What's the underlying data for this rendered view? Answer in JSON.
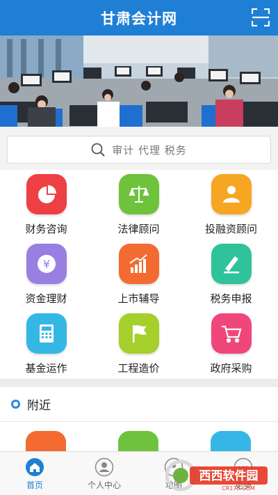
{
  "header": {
    "title": "甘肃会计网"
  },
  "search": {
    "placeholder": "审计 代理 税务"
  },
  "grid": [
    {
      "label": "财务咨询",
      "color": "#ee3f45"
    },
    {
      "label": "法律顾问",
      "color": "#6fc23c"
    },
    {
      "label": "投融资顾问",
      "color": "#f6a623"
    },
    {
      "label": "资金理财",
      "color": "#9a7fe3"
    },
    {
      "label": "上市辅导",
      "color": "#f36b31"
    },
    {
      "label": "税务申报",
      "color": "#2fc39b"
    },
    {
      "label": "基金运作",
      "color": "#35b7e6"
    },
    {
      "label": "工程造价",
      "color": "#a6cf2c"
    },
    {
      "label": "政府采购",
      "color": "#f0477a"
    }
  ],
  "nearby": {
    "label": "附近"
  },
  "bottom_nav": [
    {
      "label": "首页",
      "active": true
    },
    {
      "label": "个人中心",
      "active": false
    },
    {
      "label": "地图",
      "active": false
    },
    {
      "label": "更多",
      "active": false
    }
  ],
  "watermark": {
    "text": "西西软件园",
    "url": "CR173.COM"
  },
  "colors": {
    "brand": "#1f7fd4",
    "accent": "#2a8be0"
  }
}
